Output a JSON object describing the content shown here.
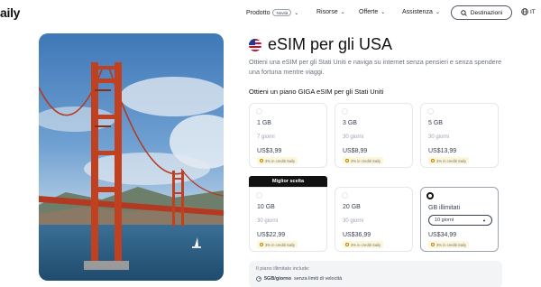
{
  "nav": {
    "logo": "aily",
    "product_label": "Prodotto",
    "product_badge": "Novità",
    "resources_label": "Risorse",
    "offers_label": "Offerte",
    "support_label": "Assistenza",
    "destinations_label": "Destinazioni",
    "language_label": "IT"
  },
  "page": {
    "title": "eSIM per gli USA",
    "description": "Ottieni una eSIM per gli Stati Uniti e naviga su internet senza pensieri e senza spendere una fortuna mentre viaggi.",
    "plans_heading": "Ottieni un piano GIGA eSIM per gli Stati Uniti"
  },
  "plans": [
    {
      "gb": "1 GB",
      "days": "7 giorni",
      "price": "US$3,99",
      "credit": "3% in crediti Saily"
    },
    {
      "gb": "3 GB",
      "days": "30 giorni",
      "price": "US$8,99",
      "credit": "3% in crediti Saily"
    },
    {
      "gb": "5 GB",
      "days": "30 giorni",
      "price": "US$13,99",
      "credit": "3% in crediti Saily"
    },
    {
      "gb": "10 GB",
      "days": "30 giorni",
      "price": "US$22,99",
      "credit": "3% in crediti Saily"
    },
    {
      "gb": "20 GB",
      "days": "30 giorni",
      "price": "US$36,99",
      "credit": "3% in crediti Saily"
    },
    {
      "gb": "GB illimitati",
      "select_value": "10 giorni",
      "price": "US$34,99",
      "credit": "3% in crediti Saily"
    }
  ],
  "best_choice_label": "Miglior scelta",
  "unlimited_info": {
    "heading": "Il piano illimitato include:",
    "feature_bold": "5GB/giorno",
    "feature_rest": "senza limiti di velocità"
  },
  "colors": {
    "accent": "#111111",
    "credit_bg": "#fdf6d8",
    "muted_text": "#9ca3af"
  }
}
